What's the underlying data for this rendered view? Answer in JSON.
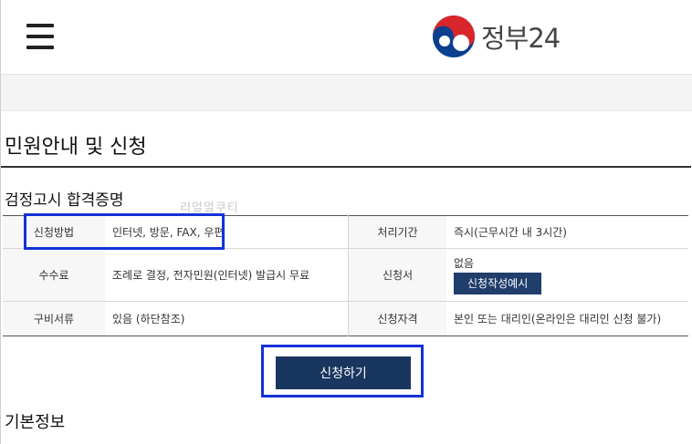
{
  "header": {
    "logo_text": "정부24",
    "menu_icon": "hamburger-menu-icon",
    "logo_icon": "government-emblem-icon"
  },
  "page_title": "민원안내 및 신청",
  "section_title": "검정고시 합격증명",
  "watermark": "리얼멀쿠티",
  "info_table": {
    "rows": [
      {
        "label1": "신청방법",
        "value1": "인터넷, 방문, FAX, 우편",
        "label2": "처리기간",
        "value2": "즉시(근무시간 내 3시간)"
      },
      {
        "label1": "수수료",
        "value1": "조례로 결정, 전자민원(인터넷) 발급시 무료",
        "label2": "신청서",
        "value2": "없음",
        "button": "신청작성예시"
      },
      {
        "label1": "구비서류",
        "value1": "있음 (하단참조)",
        "label2": "신청자격",
        "value2": "본인 또는 대리인(온라인은 대리인 신청 불가)"
      }
    ]
  },
  "apply_button": "신청하기",
  "basic_info_title": "기본정보",
  "colors": {
    "primary_button": "#18365f",
    "highlight": "#1432d8",
    "sample_button": "#1f3e6b"
  }
}
